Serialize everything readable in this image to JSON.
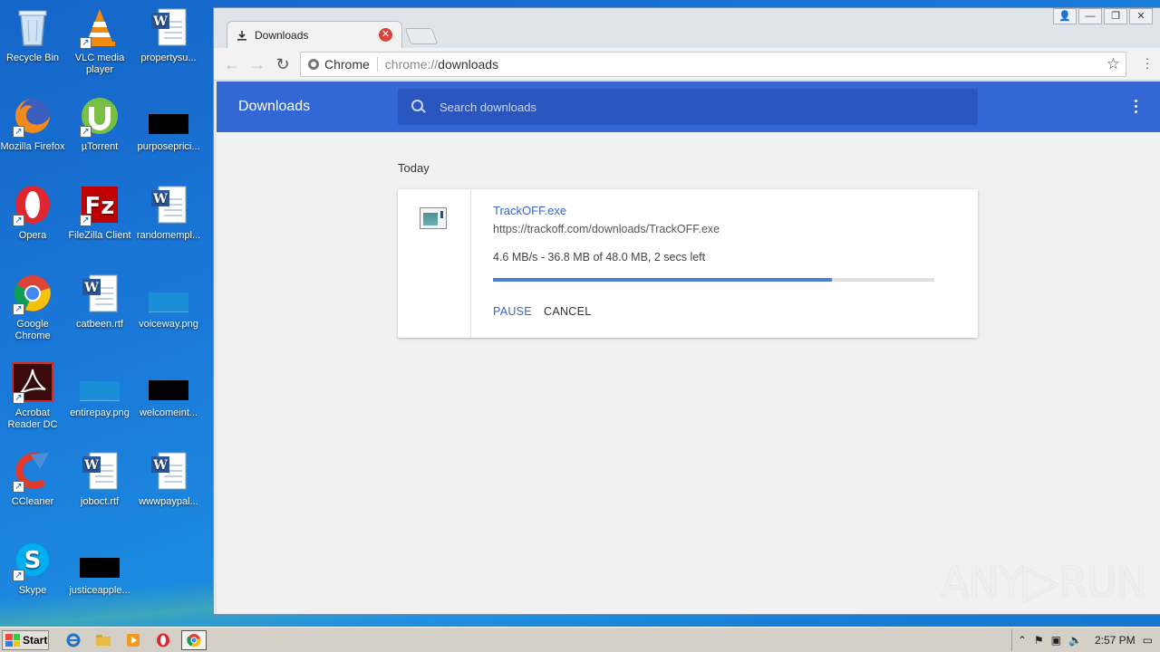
{
  "desktop": {
    "icons": [
      {
        "label": "Recycle Bin",
        "icon": "recycle-bin-icon"
      },
      {
        "label": "VLC media player",
        "icon": "vlc-icon"
      },
      {
        "label": "propertysu...",
        "icon": "word-document-icon"
      },
      {
        "label": "Mozilla Firefox",
        "icon": "firefox-icon"
      },
      {
        "label": "µTorrent",
        "icon": "utorrent-icon"
      },
      {
        "label": "purposeprici...",
        "icon": "black-thumbnail-icon"
      },
      {
        "label": "Opera",
        "icon": "opera-icon"
      },
      {
        "label": "FileZilla Client",
        "icon": "filezilla-icon"
      },
      {
        "label": "randomempl...",
        "icon": "word-document-icon"
      },
      {
        "label": "Google Chrome",
        "icon": "chrome-icon"
      },
      {
        "label": "catbeen.rtf",
        "icon": "word-document-icon"
      },
      {
        "label": "voiceway.png",
        "icon": "image-file-icon"
      },
      {
        "label": "Acrobat Reader DC",
        "icon": "acrobat-icon"
      },
      {
        "label": "entirepay.png",
        "icon": "image-file-icon"
      },
      {
        "label": "welcomeint...",
        "icon": "black-thumbnail-icon"
      },
      {
        "label": "CCleaner",
        "icon": "ccleaner-icon"
      },
      {
        "label": "joboct.rtf",
        "icon": "word-document-icon"
      },
      {
        "label": "wwwpaypal...",
        "icon": "word-document-icon"
      },
      {
        "label": "Skype",
        "icon": "skype-icon"
      },
      {
        "label": "justiceapple...",
        "icon": "black-thumbnail-icon"
      }
    ]
  },
  "browser": {
    "tab_title": "Downloads",
    "omnibox_chip": "Chrome",
    "url_scheme": "chrome://",
    "url_path": "downloads"
  },
  "downloads": {
    "header_title": "Downloads",
    "search_placeholder": "Search downloads",
    "section_date": "Today",
    "items": [
      {
        "filename": "TrackOFF.exe",
        "url": "https://trackoff.com/downloads/TrackOFF.exe",
        "status": "4.6 MB/s - 36.8 MB of 48.0 MB, 2 secs left",
        "progress_percent": 76.7,
        "pause_label": "PAUSE",
        "cancel_label": "CANCEL"
      }
    ]
  },
  "watermark": {
    "left": "ANY",
    "right": "RUN"
  },
  "taskbar": {
    "start_label": "Start",
    "clock": "2:57 PM"
  },
  "colors": {
    "header_blue": "#3367d6",
    "progress_blue": "#4a7fd8"
  }
}
